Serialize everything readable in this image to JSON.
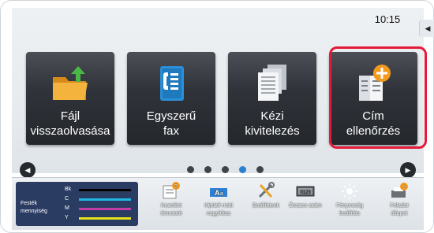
{
  "status": {
    "time": "10:15"
  },
  "tiles": [
    {
      "line1": "Fájl",
      "line2": "visszaolvasása"
    },
    {
      "line1": "Egyszerű",
      "line2": "fax"
    },
    {
      "line1": "Kézi",
      "line2": "kivitelezés"
    },
    {
      "line1": "Cím",
      "line2": "ellenőrzés"
    }
  ],
  "pager": {
    "current_page": 4,
    "total_pages": 5
  },
  "toner": {
    "label_line1": "Festék",
    "label_line2": "mennyiség",
    "channels": [
      {
        "name": "Bk",
        "color": "#000000"
      },
      {
        "name": "C",
        "color": "#1fb7e0"
      },
      {
        "name": "M",
        "color": "#c23ca7"
      },
      {
        "name": "Y",
        "color": "#e3e21d"
      }
    ]
  },
  "bottom_bar": [
    {
      "line1": "Kezelési",
      "line2": "útmutató",
      "icon": "manual-icon"
    },
    {
      "line1": "Kijelző mód",
      "line2": "nagyítása",
      "icon": "display-zoom-icon"
    },
    {
      "line1": "Beállítások",
      "line2": "",
      "icon": "settings-tools-icon"
    },
    {
      "line1": "Összes szám",
      "line2": "",
      "icon": "counter-icon"
    },
    {
      "line1": "Fényesség",
      "line2": "beállítás",
      "icon": "brightness-icon"
    },
    {
      "line1": "Feladat",
      "line2": "állapot",
      "icon": "job-status-icon"
    }
  ],
  "colors": {
    "highlight": "#e31b3a",
    "accent_blue": "#2d7fd0",
    "tile_bg": "#30343a",
    "toner_panel": "#2b3c63"
  }
}
